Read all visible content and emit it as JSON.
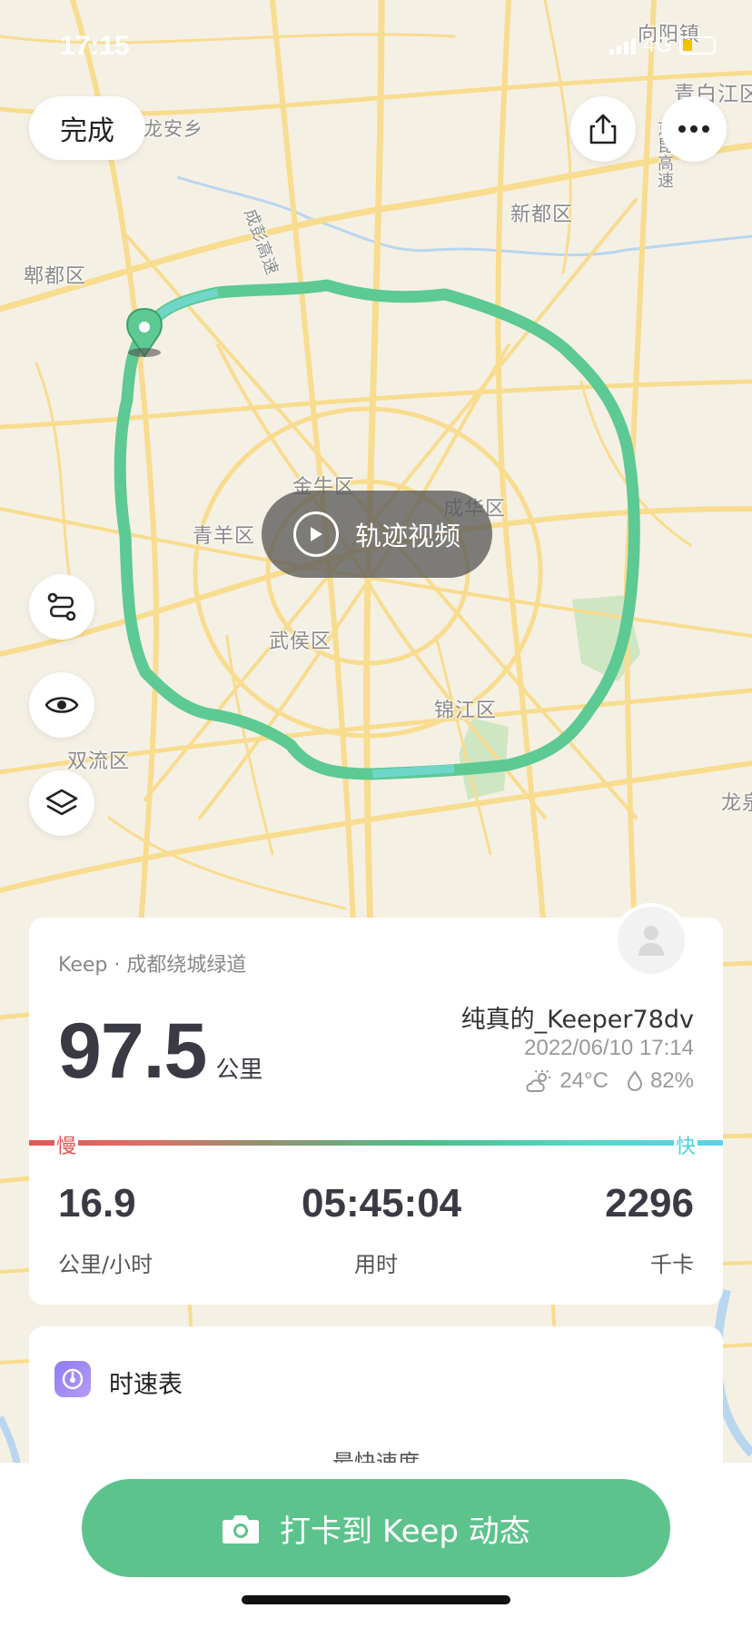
{
  "status_bar": {
    "time": "17:15",
    "network": "4G"
  },
  "header": {
    "done_label": "完成"
  },
  "map": {
    "labels": [
      {
        "text": "向阳镇"
      },
      {
        "text": "青白江区"
      },
      {
        "text": "龙安乡"
      },
      {
        "text": "新都区"
      },
      {
        "text": "郫都区"
      },
      {
        "text": "金牛区"
      },
      {
        "text": "成华区"
      },
      {
        "text": "青羊区"
      },
      {
        "text": "武侯区"
      },
      {
        "text": "锦江区"
      },
      {
        "text": "双流区"
      },
      {
        "text": "龙泉"
      },
      {
        "text": "成彭高速"
      },
      {
        "text": "京昆高速"
      }
    ],
    "route_color": "#5dc993",
    "video_label": "轨迹视频"
  },
  "summary": {
    "source": "Keep · 成都绕城绿道",
    "distance": "97.5",
    "distance_unit": "公里",
    "user_name": "纯真的_Keeper78dv",
    "datetime": "2022/06/10 17:14",
    "temperature": "24°C",
    "humidity": "82%",
    "slow_label": "慢",
    "fast_label": "快",
    "stats": [
      {
        "value": "16.9",
        "label": "公里/小时"
      },
      {
        "value": "05:45:04",
        "label": "用时"
      },
      {
        "value": "2296",
        "label": "千卡"
      }
    ]
  },
  "speed_card": {
    "title": "时速表",
    "subtitle": "最快速度"
  },
  "checkin": {
    "label": "打卡到 Keep 动态"
  },
  "colors": {
    "accent": "#5dc38c",
    "slow": "#e25656",
    "fast": "#4ecfe0"
  }
}
